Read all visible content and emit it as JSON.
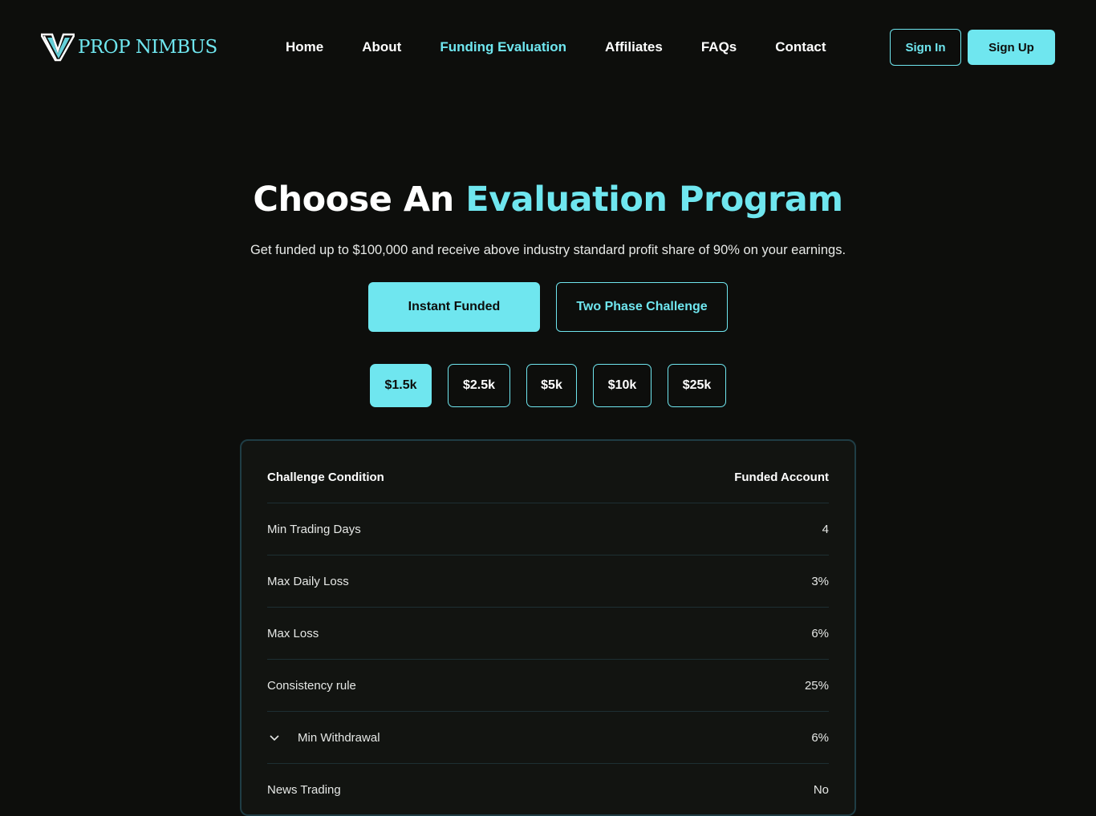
{
  "brand": {
    "name": "PROP NIMBUS",
    "logo_icon": "nimbus-logo-icon",
    "accent": "#6fe6ef",
    "background": "#0d0e0c"
  },
  "nav": {
    "items": [
      {
        "label": "Home"
      },
      {
        "label": "About"
      },
      {
        "label": "Funding Evaluation",
        "active": true
      },
      {
        "label": "Affiliates"
      },
      {
        "label": "FAQs"
      },
      {
        "label": "Contact"
      }
    ],
    "sign_in": "Sign In",
    "sign_up": "Sign Up"
  },
  "hero": {
    "title_plain": "Choose An",
    "title_accent": "Evaluation Program",
    "subtitle": "Get funded up to $100,000 and receive above industry standard profit share of 90% on your earnings."
  },
  "programs": {
    "selected": "Instant Funded",
    "items": [
      "Instant Funded",
      "Two Phase Challenge"
    ]
  },
  "sizes": {
    "selected": "$1.5k",
    "items": [
      "$1.5k",
      "$2.5k",
      "$5k",
      "$10k",
      "$25k"
    ]
  },
  "table": {
    "header": {
      "left": "Challenge Condition",
      "right": "Funded Account"
    },
    "rows": [
      {
        "label": "Min Trading Days",
        "value": "4"
      },
      {
        "label": "Max Daily Loss",
        "value": "3%"
      },
      {
        "label": "Max Loss",
        "value": "6%"
      },
      {
        "label": "Consistency rule",
        "value": "25%"
      },
      {
        "label": "Min Withdrawal",
        "value": "6%",
        "icon": "chevron-down-icon"
      },
      {
        "label": "News Trading",
        "value": "No"
      }
    ]
  }
}
